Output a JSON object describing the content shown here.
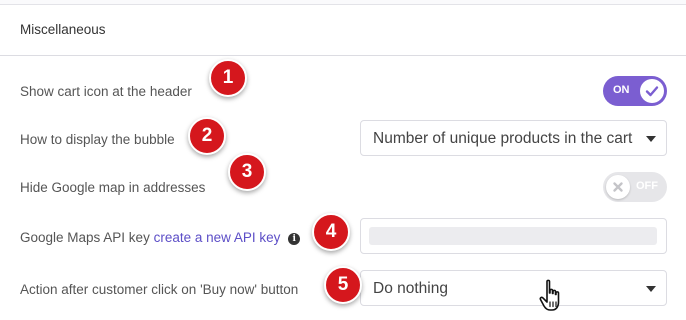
{
  "section": {
    "title": "Miscellaneous"
  },
  "settings": {
    "cart_icon": {
      "label": "Show cart icon at the header",
      "toggle_label": "ON",
      "enabled": true
    },
    "bubble": {
      "label": "How to display the bubble",
      "selected": "Number of unique products in the cart"
    },
    "google_map": {
      "label": "Hide Google map in addresses",
      "toggle_label": "OFF",
      "enabled": false
    },
    "api_key": {
      "label": "Google Maps API key",
      "link_text": "create a new API key",
      "info_icon": "i"
    },
    "buy_now": {
      "label": "Action after customer click on 'Buy now' button",
      "selected": "Do nothing"
    }
  },
  "badges": [
    "1",
    "2",
    "3",
    "4",
    "5"
  ],
  "colors": {
    "accent": "#7b5ed1",
    "badge": "#d5171d",
    "link": "#5c4ec7"
  },
  "icons": [
    "check-icon",
    "x-icon",
    "info-icon",
    "caret-down-icon",
    "hand-pointer-icon"
  ]
}
